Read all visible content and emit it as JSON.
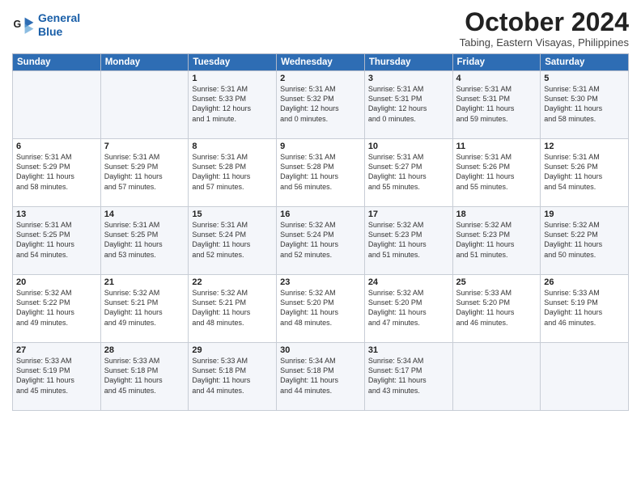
{
  "logo": {
    "line1": "General",
    "line2": "Blue"
  },
  "title": "October 2024",
  "subtitle": "Tabing, Eastern Visayas, Philippines",
  "days_of_week": [
    "Sunday",
    "Monday",
    "Tuesday",
    "Wednesday",
    "Thursday",
    "Friday",
    "Saturday"
  ],
  "weeks": [
    [
      {
        "day": "",
        "content": ""
      },
      {
        "day": "",
        "content": ""
      },
      {
        "day": "1",
        "content": "Sunrise: 5:31 AM\nSunset: 5:33 PM\nDaylight: 12 hours\nand 1 minute."
      },
      {
        "day": "2",
        "content": "Sunrise: 5:31 AM\nSunset: 5:32 PM\nDaylight: 12 hours\nand 0 minutes."
      },
      {
        "day": "3",
        "content": "Sunrise: 5:31 AM\nSunset: 5:31 PM\nDaylight: 12 hours\nand 0 minutes."
      },
      {
        "day": "4",
        "content": "Sunrise: 5:31 AM\nSunset: 5:31 PM\nDaylight: 11 hours\nand 59 minutes."
      },
      {
        "day": "5",
        "content": "Sunrise: 5:31 AM\nSunset: 5:30 PM\nDaylight: 11 hours\nand 58 minutes."
      }
    ],
    [
      {
        "day": "6",
        "content": "Sunrise: 5:31 AM\nSunset: 5:29 PM\nDaylight: 11 hours\nand 58 minutes."
      },
      {
        "day": "7",
        "content": "Sunrise: 5:31 AM\nSunset: 5:29 PM\nDaylight: 11 hours\nand 57 minutes."
      },
      {
        "day": "8",
        "content": "Sunrise: 5:31 AM\nSunset: 5:28 PM\nDaylight: 11 hours\nand 57 minutes."
      },
      {
        "day": "9",
        "content": "Sunrise: 5:31 AM\nSunset: 5:28 PM\nDaylight: 11 hours\nand 56 minutes."
      },
      {
        "day": "10",
        "content": "Sunrise: 5:31 AM\nSunset: 5:27 PM\nDaylight: 11 hours\nand 55 minutes."
      },
      {
        "day": "11",
        "content": "Sunrise: 5:31 AM\nSunset: 5:26 PM\nDaylight: 11 hours\nand 55 minutes."
      },
      {
        "day": "12",
        "content": "Sunrise: 5:31 AM\nSunset: 5:26 PM\nDaylight: 11 hours\nand 54 minutes."
      }
    ],
    [
      {
        "day": "13",
        "content": "Sunrise: 5:31 AM\nSunset: 5:25 PM\nDaylight: 11 hours\nand 54 minutes."
      },
      {
        "day": "14",
        "content": "Sunrise: 5:31 AM\nSunset: 5:25 PM\nDaylight: 11 hours\nand 53 minutes."
      },
      {
        "day": "15",
        "content": "Sunrise: 5:31 AM\nSunset: 5:24 PM\nDaylight: 11 hours\nand 52 minutes."
      },
      {
        "day": "16",
        "content": "Sunrise: 5:32 AM\nSunset: 5:24 PM\nDaylight: 11 hours\nand 52 minutes."
      },
      {
        "day": "17",
        "content": "Sunrise: 5:32 AM\nSunset: 5:23 PM\nDaylight: 11 hours\nand 51 minutes."
      },
      {
        "day": "18",
        "content": "Sunrise: 5:32 AM\nSunset: 5:23 PM\nDaylight: 11 hours\nand 51 minutes."
      },
      {
        "day": "19",
        "content": "Sunrise: 5:32 AM\nSunset: 5:22 PM\nDaylight: 11 hours\nand 50 minutes."
      }
    ],
    [
      {
        "day": "20",
        "content": "Sunrise: 5:32 AM\nSunset: 5:22 PM\nDaylight: 11 hours\nand 49 minutes."
      },
      {
        "day": "21",
        "content": "Sunrise: 5:32 AM\nSunset: 5:21 PM\nDaylight: 11 hours\nand 49 minutes."
      },
      {
        "day": "22",
        "content": "Sunrise: 5:32 AM\nSunset: 5:21 PM\nDaylight: 11 hours\nand 48 minutes."
      },
      {
        "day": "23",
        "content": "Sunrise: 5:32 AM\nSunset: 5:20 PM\nDaylight: 11 hours\nand 48 minutes."
      },
      {
        "day": "24",
        "content": "Sunrise: 5:32 AM\nSunset: 5:20 PM\nDaylight: 11 hours\nand 47 minutes."
      },
      {
        "day": "25",
        "content": "Sunrise: 5:33 AM\nSunset: 5:20 PM\nDaylight: 11 hours\nand 46 minutes."
      },
      {
        "day": "26",
        "content": "Sunrise: 5:33 AM\nSunset: 5:19 PM\nDaylight: 11 hours\nand 46 minutes."
      }
    ],
    [
      {
        "day": "27",
        "content": "Sunrise: 5:33 AM\nSunset: 5:19 PM\nDaylight: 11 hours\nand 45 minutes."
      },
      {
        "day": "28",
        "content": "Sunrise: 5:33 AM\nSunset: 5:18 PM\nDaylight: 11 hours\nand 45 minutes."
      },
      {
        "day": "29",
        "content": "Sunrise: 5:33 AM\nSunset: 5:18 PM\nDaylight: 11 hours\nand 44 minutes."
      },
      {
        "day": "30",
        "content": "Sunrise: 5:34 AM\nSunset: 5:18 PM\nDaylight: 11 hours\nand 44 minutes."
      },
      {
        "day": "31",
        "content": "Sunrise: 5:34 AM\nSunset: 5:17 PM\nDaylight: 11 hours\nand 43 minutes."
      },
      {
        "day": "",
        "content": ""
      },
      {
        "day": "",
        "content": ""
      }
    ]
  ]
}
